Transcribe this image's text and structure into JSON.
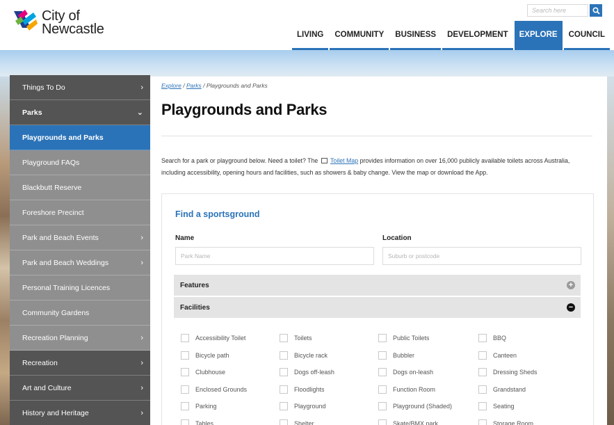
{
  "header": {
    "logo_line1": "City of",
    "logo_line2": "Newcastle",
    "search_placeholder": "Search here",
    "nav": [
      "LIVING",
      "COMMUNITY",
      "BUSINESS",
      "DEVELOPMENT",
      "EXPLORE",
      "COUNCIL"
    ],
    "nav_active": "EXPLORE"
  },
  "sidebar": {
    "items": [
      {
        "label": "Things To Do",
        "chevron": "›"
      },
      {
        "label": "Parks",
        "chevron": "⌄"
      },
      {
        "label": "Playgrounds and Parks",
        "chevron": ""
      },
      {
        "label": "Playground FAQs",
        "chevron": ""
      },
      {
        "label": "Blackbutt Reserve",
        "chevron": ""
      },
      {
        "label": "Foreshore Precinct",
        "chevron": ""
      },
      {
        "label": "Park and Beach Events",
        "chevron": "›"
      },
      {
        "label": "Park and Beach Weddings",
        "chevron": "›"
      },
      {
        "label": "Personal Training Licences",
        "chevron": ""
      },
      {
        "label": "Community Gardens",
        "chevron": ""
      },
      {
        "label": "Recreation Planning",
        "chevron": "›"
      },
      {
        "label": "Recreation",
        "chevron": "›"
      },
      {
        "label": "Art and Culture",
        "chevron": "›"
      },
      {
        "label": "History and Heritage",
        "chevron": "›"
      }
    ]
  },
  "breadcrumb": {
    "items": [
      "Explore",
      "Parks"
    ],
    "separator": "/",
    "current": "Playgrounds and Parks"
  },
  "main": {
    "title": "Playgrounds and Parks",
    "intro_before": "Search for a park or playground below.  Need a toilet? The",
    "intro_link": "Toilet Map",
    "intro_after": "provides information on over 16,000 publicly available toilets across Australia, including accessibility, opening hours and facilities, such as showers & baby change. View the map or download the App."
  },
  "finder": {
    "title": "Find a sportsground",
    "name_label": "Name",
    "name_placeholder": "Park Name",
    "location_label": "Location",
    "location_placeholder": "Suburb or postcode",
    "features_label": "Features",
    "facilities_label": "Facilities",
    "facilities": [
      "Accessibility Toilet",
      "Toilets",
      "Public Toilets",
      "BBQ",
      "Bicycle path",
      "Bicycle rack",
      "Bubbler",
      "Canteen",
      "Clubhouse",
      "Dogs off-leash",
      "Dogs on-leash",
      "Dressing Sheds",
      "Enclosed Grounds",
      "Floodlights",
      "Function Room",
      "Grandstand",
      "Parking",
      "Playground",
      "Playground (Shaded)",
      "Seating",
      "Tables",
      "Shelter",
      "Skate/BMX park",
      "Storage Room"
    ]
  },
  "colors": {
    "accent": "#2b73b8",
    "sidebar_dark": "#545454",
    "sidebar_light": "#8f8f8f"
  }
}
